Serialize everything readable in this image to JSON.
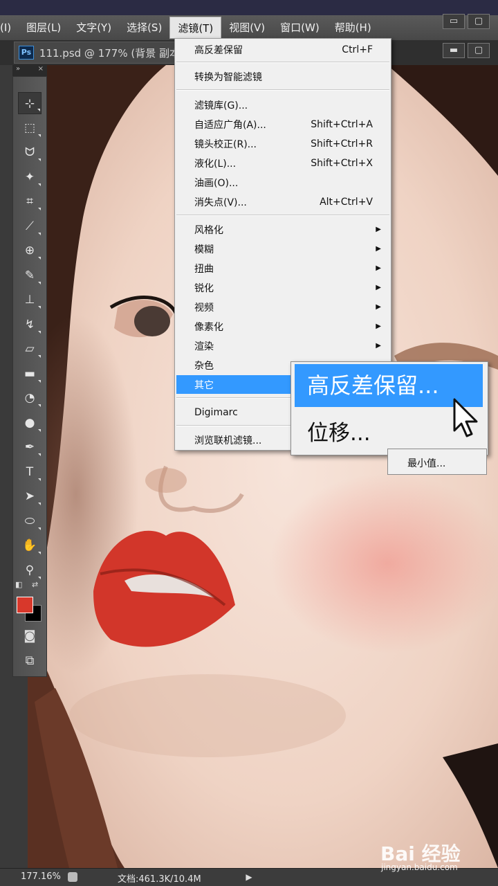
{
  "menubar": {
    "items": [
      "(I)",
      "图层(L)",
      "文字(Y)",
      "选择(S)",
      "滤镜(T)",
      "视图(V)",
      "窗口(W)",
      "帮助(H)"
    ],
    "active_index": 4,
    "window_buttons": [
      "▭",
      "▢"
    ]
  },
  "document": {
    "tab_title": "111.psd @ 177% (背景 副本",
    "ps_logo": "Ps",
    "tab_buttons": [
      "▬",
      "▢"
    ]
  },
  "tools_panel": {
    "header_left": "»",
    "header_right": "×",
    "icons": [
      "move-tool-icon",
      "marquee-tool-icon",
      "lasso-tool-icon",
      "magic-wand-icon",
      "crop-tool-icon",
      "eyedropper-icon",
      "healing-brush-icon",
      "brush-tool-icon",
      "stamp-tool-icon",
      "history-brush-icon",
      "eraser-icon",
      "gradient-icon",
      "blur-tool-icon",
      "dodge-tool-icon",
      "pen-tool-icon",
      "type-tool-icon",
      "path-select-icon",
      "ellipse-tool-icon",
      "hand-tool-icon",
      "zoom-tool-icon"
    ],
    "glyphs": [
      "⊹",
      "⬚",
      "ᗢ",
      "✦",
      "⌗",
      "⟋",
      "⊕",
      "✎",
      "⊥",
      "↯",
      "▱",
      "▬",
      "◔",
      "●",
      "✒",
      "T",
      "➤",
      "⬭",
      "✋",
      "⚲"
    ],
    "foreground_color": "#d8382b",
    "background_color": "#000000",
    "quickmask_glyph": "◙",
    "screenmode_glyph": "⧉"
  },
  "filter_menu": {
    "last_filter": {
      "label": "高反差保留",
      "shortcut": "Ctrl+F"
    },
    "convert_smart": "转换为智能滤镜",
    "group2": [
      {
        "label": "滤镜库(G)...",
        "shortcut": ""
      },
      {
        "label": "自适应广角(A)...",
        "shortcut": "Shift+Ctrl+A"
      },
      {
        "label": "镜头校正(R)...",
        "shortcut": "Shift+Ctrl+R"
      },
      {
        "label": "液化(L)...",
        "shortcut": "Shift+Ctrl+X"
      },
      {
        "label": "油画(O)...",
        "shortcut": ""
      },
      {
        "label": "消失点(V)...",
        "shortcut": "Alt+Ctrl+V"
      }
    ],
    "group3": [
      "风格化",
      "模糊",
      "扭曲",
      "锐化",
      "视频",
      "像素化",
      "渲染",
      "杂色",
      "其它"
    ],
    "highlighted": "其它",
    "digimarc": "Digimarc",
    "browse_online": "浏览联机滤镜..."
  },
  "sub_menu": {
    "highlighted": "高反差保留...",
    "item2": "位移...",
    "item3": "最小值..."
  },
  "statusbar": {
    "zoom": "177.16%",
    "doc_info": "文档:461.3K/10.4M",
    "play": "▶"
  },
  "watermark": {
    "logo": "Bai 经验",
    "url": "jingyan.baidu.com"
  }
}
